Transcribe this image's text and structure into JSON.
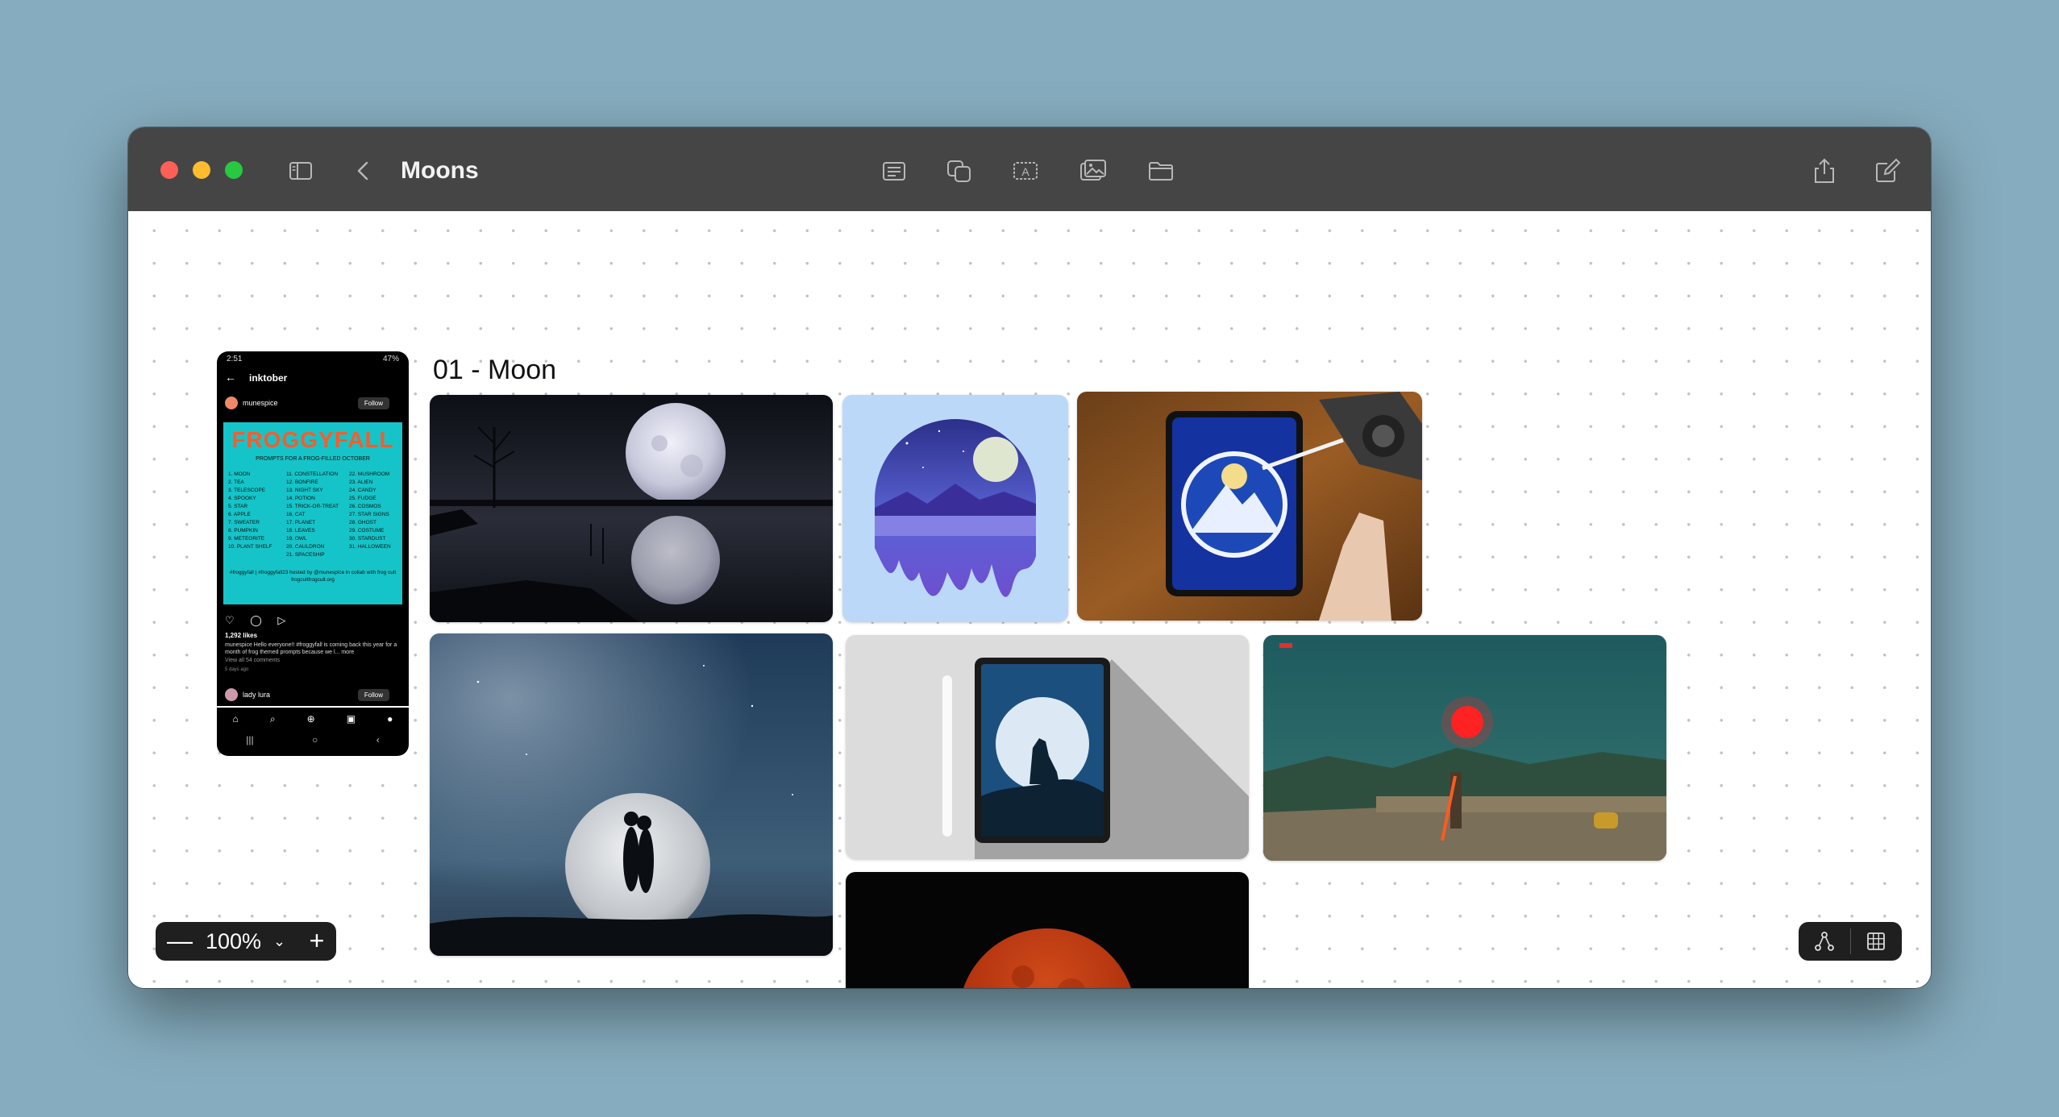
{
  "window": {
    "title": "Moons",
    "colors": {
      "titlebar": "#454545",
      "canvas": "#ffffff",
      "desktop": "#86adbf"
    }
  },
  "toolbar": {
    "icons": [
      "sidebar-icon",
      "back-chevron-icon",
      "text-block-icon",
      "shapes-icon",
      "text-box-icon",
      "image-icon",
      "folder-icon",
      "share-icon",
      "compose-icon"
    ]
  },
  "canvas": {
    "group_label": "01 - Moon",
    "images": [
      "moon-over-lake",
      "moon-dripping-illustration",
      "ipad-moon-mountain-drawing",
      "couple-silhouette-moon",
      "ipad-wolf-howling-moon",
      "game-screenshot-cliff",
      "blood-moon"
    ]
  },
  "phone": {
    "status_time": "2:51",
    "status_right": "47%",
    "header": "inktober",
    "username": "munespice",
    "follow_label": "Follow",
    "post_title": "FROGGYFALL",
    "post_subtitle": "PROMPTS FOR A FROG-FILLED OCTOBER",
    "prompts_col1": [
      "1. MOON",
      "2. TEA",
      "3. TELESCOPE",
      "4. SPOOKY",
      "5. STAR",
      "6. APPLE",
      "7. SWEATER",
      "8. PUMPKIN",
      "9. METEORITE",
      "10. PLANT SHELF"
    ],
    "prompts_col2": [
      "11. CONSTELLATION",
      "12. BONFIRE",
      "13. NIGHT SKY",
      "14. POTION",
      "15. TRICK-OR-TREAT",
      "16. CAT",
      "17. PLANET",
      "18. LEAVES",
      "19. OWL",
      "20. CAULDRON",
      "21. SPACESHIP"
    ],
    "prompts_col3": [
      "22. MUSHROOM",
      "23. ALIEN",
      "24. CANDY",
      "25. FUDGE",
      "26. COSMOS",
      "27. STAR SIGNS",
      "28. GHOST",
      "29. COSTUME",
      "30. STARDUST",
      "31. HALLOWEEN"
    ],
    "post_footer": "#froggyfall | #froggyfall23 hosted by @munespice in collab with frog cult frogcultfrogcult.org",
    "likes": "1,292 likes",
    "caption": "munespice Hello everyone!! #froggyfall is coming back this year for a month of frog themed prompts because we l... more",
    "comments": "View all 54 comments",
    "days_ago": "5 days ago",
    "commenter": "lady lura",
    "follow_label_2": "Follow"
  },
  "zoom": {
    "value": "100%",
    "minus": "—",
    "plus": "+"
  }
}
